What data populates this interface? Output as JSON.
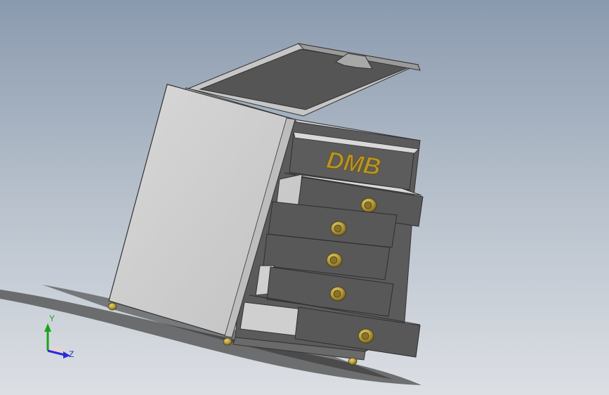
{
  "model": {
    "logo_text": "DMB",
    "drawer_count": 5
  },
  "triad": {
    "y_label": "Y",
    "z_label": "Z"
  },
  "colors": {
    "background_top": "#8a9aae",
    "background_bottom": "#dcdfe4",
    "panel_light": "#cfcfcf",
    "panel_dark": "#4d4d4d",
    "knob_gold": "#b59a3e",
    "axis_y": "#1aa31a",
    "axis_z": "#2b2bd6"
  }
}
